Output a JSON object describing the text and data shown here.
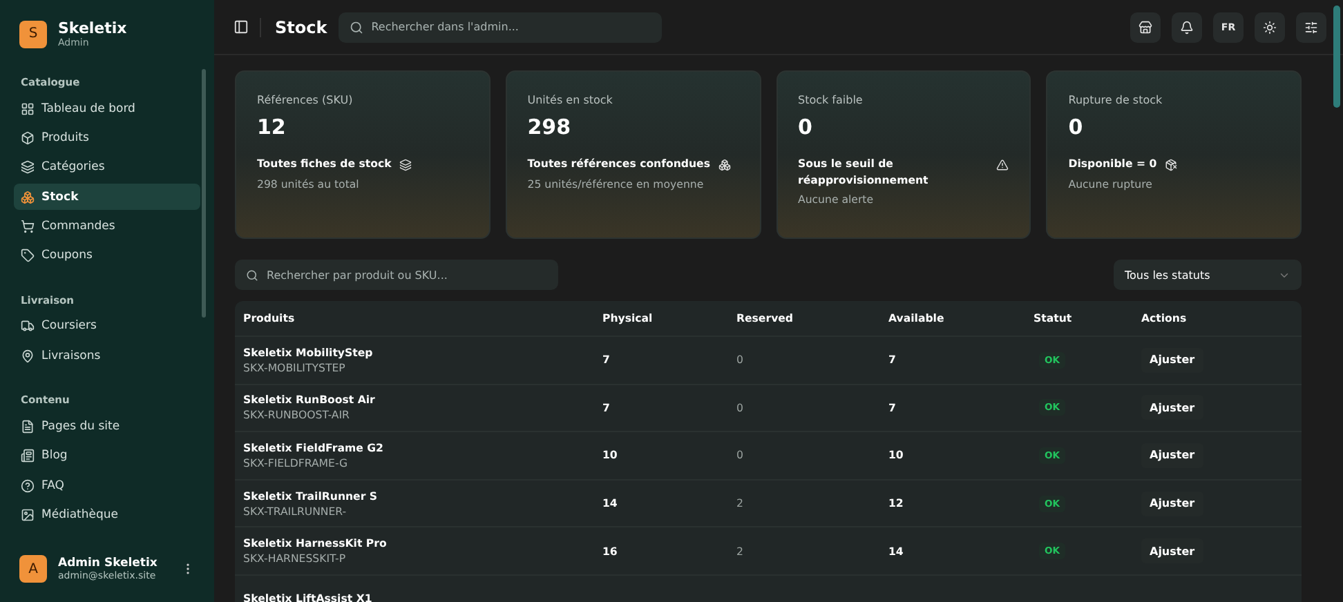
{
  "brand": {
    "name": "Skeletix",
    "role": "Admin",
    "logo": "S"
  },
  "sidebar": {
    "sections": [
      {
        "title": "Catalogue",
        "items": [
          {
            "label": "Tableau de bord",
            "selected": false
          },
          {
            "label": "Produits",
            "selected": false
          },
          {
            "label": "Catégories",
            "selected": false
          },
          {
            "label": "Stock",
            "selected": true
          },
          {
            "label": "Commandes",
            "selected": false
          },
          {
            "label": "Coupons",
            "selected": false
          }
        ]
      },
      {
        "title": "Livraison",
        "items": [
          {
            "label": "Coursiers",
            "selected": false
          },
          {
            "label": "Livraisons",
            "selected": false
          }
        ]
      },
      {
        "title": "Contenu",
        "items": [
          {
            "label": "Pages du site",
            "selected": false
          },
          {
            "label": "Blog",
            "selected": false
          },
          {
            "label": "FAQ",
            "selected": false
          },
          {
            "label": "Médiathèque",
            "selected": false
          }
        ]
      }
    ]
  },
  "user": {
    "initial": "A",
    "name": "Admin Skeletix",
    "email": "admin@skeletix.site"
  },
  "header": {
    "title": "Stock",
    "search_placeholder": "Rechercher dans l'admin...",
    "language": "FR"
  },
  "cards": [
    {
      "label": "Références (SKU)",
      "value": "12",
      "title": "Toutes fiches de stock",
      "note": "298 unités au total"
    },
    {
      "label": "Unités en stock",
      "value": "298",
      "title": "Toutes références confondues",
      "note": "25 unités/référence en moyenne"
    },
    {
      "label": "Stock faible",
      "value": "0",
      "title": "Sous le seuil de réapprovisionnement",
      "note": "Aucune alerte"
    },
    {
      "label": "Rupture de stock",
      "value": "0",
      "title": "Disponible = 0",
      "note": "Aucune rupture"
    }
  ],
  "filters": {
    "search_placeholder": "Rechercher par produit ou SKU...",
    "status": "Tous les statuts"
  },
  "table": {
    "columns": [
      "Produits",
      "Physical",
      "Reserved",
      "Available",
      "Statut",
      "Actions"
    ],
    "rows": [
      {
        "name": "Skeletix MobilityStep",
        "sku": "SKX-MOBILITYSTEP",
        "physical": "7",
        "reserved": "0",
        "available": "7",
        "status": "OK",
        "action": "Ajuster"
      },
      {
        "name": "Skeletix RunBoost Air",
        "sku": "SKX-RUNBOOST-AIR",
        "physical": "7",
        "reserved": "0",
        "available": "7",
        "status": "OK",
        "action": "Ajuster"
      },
      {
        "name": "Skeletix FieldFrame G2",
        "sku": "SKX-FIELDFRAME-G",
        "physical": "10",
        "reserved": "0",
        "available": "10",
        "status": "OK",
        "action": "Ajuster"
      },
      {
        "name": "Skeletix TrailRunner S",
        "sku": "SKX-TRAILRUNNER-",
        "physical": "14",
        "reserved": "2",
        "available": "12",
        "status": "OK",
        "action": "Ajuster"
      },
      {
        "name": "Skeletix HarnessKit Pro",
        "sku": "SKX-HARNESSKIT-P",
        "physical": "16",
        "reserved": "2",
        "available": "14",
        "status": "OK",
        "action": "Ajuster"
      },
      {
        "name": "Skeletix LiftAssist X1"
      }
    ]
  }
}
